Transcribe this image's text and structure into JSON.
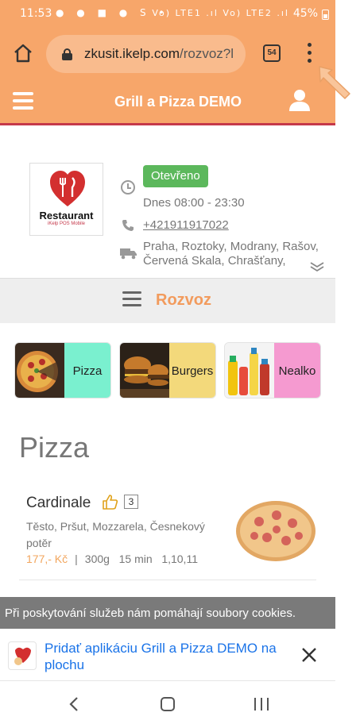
{
  "status_bar": {
    "time": "11:53",
    "left_icons": "● ● ■ ● S •",
    "network": "Vo) LTE1 .ıl Vo) LTE2 .ıl",
    "battery": "45%"
  },
  "browser": {
    "url_domain": "zkusit.ikelp.com",
    "url_path": "/rozvoz?l",
    "tab_count": "54"
  },
  "header": {
    "title": "Grill a Pizza DEMO"
  },
  "info": {
    "logo_word": "Restaurant",
    "logo_sub": "iKelp POS Mobile",
    "status": "Otevřeno",
    "hours": "Dnes 08:00 - 23:30",
    "phone": "+421911917022",
    "address": "Praha, Roztoky, Modrany, Rašov, Červená Skala, Chrašťany,"
  },
  "section": {
    "title": "Rozvoz"
  },
  "categories": [
    {
      "label": "Pizza",
      "color": "#7af0cf"
    },
    {
      "label": "Burgers",
      "color": "#f3d97b"
    },
    {
      "label": "Nealko",
      "color": "#f59ad0"
    }
  ],
  "menu_section": {
    "heading": "Pizza"
  },
  "product": {
    "name": "Cardinale",
    "likes": "3",
    "description": "Těsto, Pršut, Mozzarela, Česnekový potěr",
    "price": "177,- Kč",
    "separator": "|",
    "weight": "300g",
    "time": "15 min",
    "allergens": "1,10,11"
  },
  "cookie": {
    "text": "Při poskytování služeb nám pomáhají soubory cookies."
  },
  "install": {
    "text": "Pridať aplikáciu Grill a Pizza DEMO na plochu"
  },
  "colors": {
    "brand": "#f7a66a",
    "accent_red": "#c5384a",
    "open_green": "#5cb85c",
    "link_blue": "#1a73e8"
  }
}
